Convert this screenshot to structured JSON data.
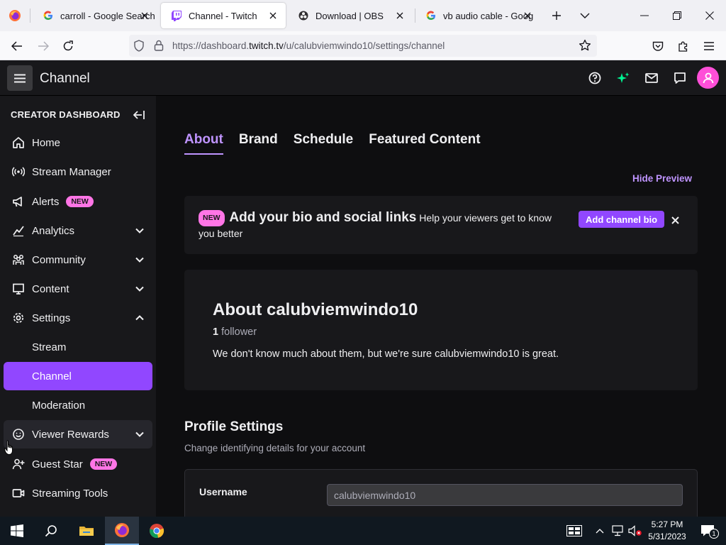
{
  "browser": {
    "tabs": [
      {
        "title": "carroll - Google Search",
        "favicon": "google-icon"
      },
      {
        "title": "Channel - Twitch",
        "favicon": "twitch-icon",
        "active": true
      },
      {
        "title": "Download | OBS",
        "favicon": "obs-icon"
      },
      {
        "title": "vb audio cable - Google",
        "favicon": "google-icon"
      }
    ],
    "url": {
      "prefix": "https://dashboard.",
      "domain": "twitch.tv",
      "path": "/u/calubviemwindo10/settings/channel"
    }
  },
  "topbar": {
    "title": "Channel"
  },
  "sidebar": {
    "heading": "CREATOR DASHBOARD",
    "items": [
      {
        "label": "Home",
        "icon": "home-icon"
      },
      {
        "label": "Stream Manager",
        "icon": "broadcast-icon"
      },
      {
        "label": "Alerts",
        "icon": "alerts-icon",
        "badge": "NEW"
      },
      {
        "label": "Analytics",
        "icon": "analytics-icon",
        "chevron": "down"
      },
      {
        "label": "Community",
        "icon": "community-icon",
        "chevron": "down"
      },
      {
        "label": "Content",
        "icon": "content-icon",
        "chevron": "down"
      },
      {
        "label": "Settings",
        "icon": "gear-icon",
        "chevron": "up"
      },
      {
        "label": "Stream"
      },
      {
        "label": "Channel",
        "active": true
      },
      {
        "label": "Moderation"
      },
      {
        "label": "Viewer Rewards",
        "icon": "rewards-icon",
        "chevron": "down"
      },
      {
        "label": "Guest Star",
        "icon": "add-person-icon",
        "badge": "NEW"
      },
      {
        "label": "Streaming Tools",
        "icon": "camera-icon"
      }
    ]
  },
  "main": {
    "tabs": [
      "About",
      "Brand",
      "Schedule",
      "Featured Content"
    ],
    "hide_preview": "Hide Preview",
    "promo": {
      "badge": "NEW",
      "heading": "Add your bio and social links",
      "text": "Help your viewers get to know you better",
      "button": "Add channel bio"
    },
    "about": {
      "title": "About calubviemwindo10",
      "follower_count": "1",
      "follower_label": "follower",
      "description": "We don't know much about them, but we're sure calubviemwindo10 is great."
    },
    "profile_settings": {
      "title": "Profile Settings",
      "subtitle": "Change identifying details for your account",
      "username_label": "Username",
      "username_value": "calubviemwindo10"
    }
  },
  "taskbar": {
    "time": "5:27 PM",
    "date": "5/31/2023",
    "notification_count": "1"
  },
  "colors": {
    "accent": "#9147ff",
    "accent_text": "#bf94ff",
    "badge_pink": "#ff75e6",
    "background": "#0e0e10",
    "panel": "#18181b"
  }
}
